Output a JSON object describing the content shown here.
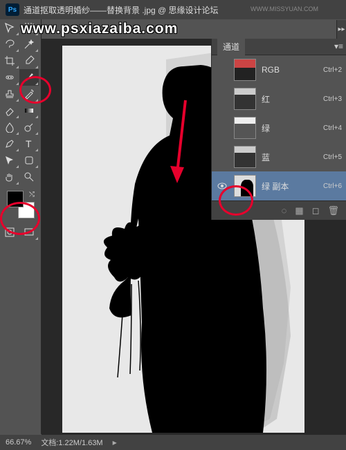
{
  "titlebar": {
    "app": "Ps",
    "title": "通道抠取透明婚纱——替换背景 .jpg @ 思缘设计论坛"
  },
  "watermark": "www.psxiazaiba.com",
  "top_watermark": "WWW.MISSYUAN.COM",
  "panel": {
    "tab": "通道",
    "channels": [
      {
        "label": "RGB",
        "shortcut": "Ctrl+2",
        "eye": false
      },
      {
        "label": "红",
        "shortcut": "Ctrl+3",
        "eye": false
      },
      {
        "label": "绿",
        "shortcut": "Ctrl+4",
        "eye": false
      },
      {
        "label": "蓝",
        "shortcut": "Ctrl+5",
        "eye": false
      },
      {
        "label": "绿 副本",
        "shortcut": "Ctrl+6",
        "eye": true
      }
    ]
  },
  "statusbar": {
    "zoom": "66.67%",
    "docinfo": "文档:1.22M/1.63M"
  },
  "tools": {
    "move": "move",
    "marquee": "marquee",
    "lasso": "lasso",
    "wand": "wand",
    "crop": "crop",
    "eyedropper": "eyedropper",
    "healing": "healing",
    "brush": "brush",
    "stamp": "stamp",
    "history": "history",
    "eraser": "eraser",
    "gradient": "gradient",
    "blur": "blur",
    "dodge": "dodge",
    "pen": "pen",
    "type": "type",
    "path": "path",
    "shape": "shape",
    "hand": "hand",
    "zoom": "zoom"
  }
}
